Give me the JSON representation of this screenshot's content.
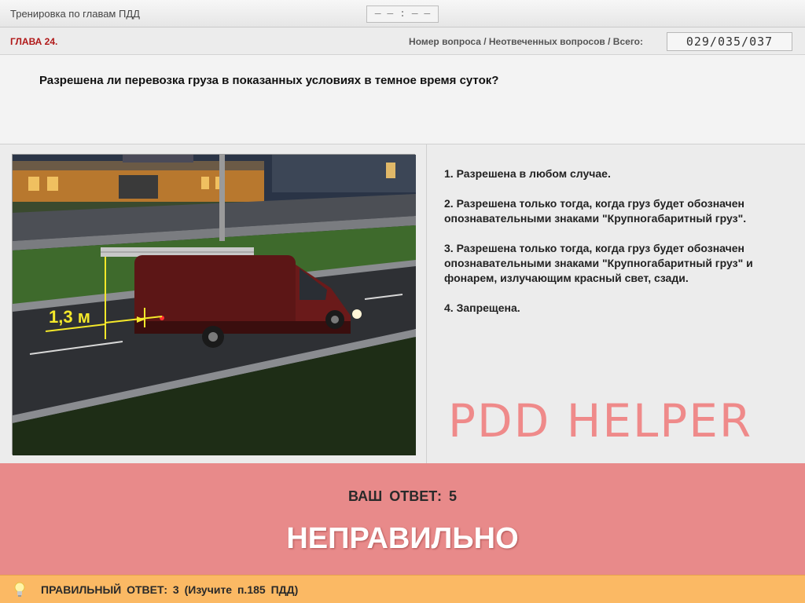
{
  "window": {
    "title": "Тренировка по главам ПДД",
    "timer": "– – : – –"
  },
  "chapter": {
    "label": "ГЛАВА 24.",
    "counter_label": "Номер вопроса / Неотвеченных вопросов / Всего:",
    "counter_value": "029/035/037"
  },
  "question": {
    "text": "Разрешена ли перевозка груза в показанных условиях в темное время суток?"
  },
  "image": {
    "annotation": "1,3 м"
  },
  "answers": [
    {
      "text": "1.  Разрешена в любом случае."
    },
    {
      "text": "2.  Разрешена только тогда, когда груз будет обозначен опознавательными знаками \"Крупногабаритный груз\"."
    },
    {
      "text": "3.  Разрешена только тогда, когда груз будет обозначен опознавательными знаками \"Крупногабаритный груз\" и фонарем, излучающим красный свет, сзади."
    },
    {
      "text": "4.  Запрещена."
    }
  ],
  "watermark": "PDD HELPER",
  "result": {
    "your_answer": "ВАШ ОТВЕТ:  5",
    "verdict": "НЕПРАВИЛЬНО"
  },
  "hint": {
    "text": "ПРАВИЛЬНЫЙ ОТВЕТ:   3   (Изучите п.185 ПДД)",
    "icon": "lightbulb-icon"
  },
  "colors": {
    "chapter_red": "#b01818",
    "result_bg": "#e88a8a",
    "hint_bg": "#fbb964",
    "watermark": "#ef8a8a"
  }
}
